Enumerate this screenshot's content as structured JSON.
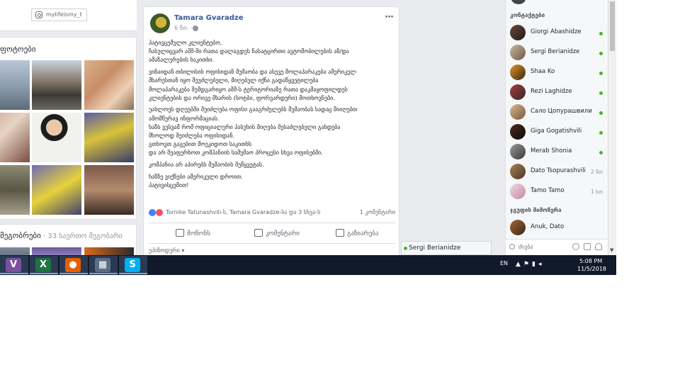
{
  "left_column": {
    "instagram_handle": "mylifeismy_t",
    "photos_title": "ფოტოები",
    "friends_title": "მეგობრები",
    "friends_count": " · 33 საერთო მეგობარი"
  },
  "post": {
    "author": "Tamara Gvaradze",
    "time": "6 წთ. ·",
    "menu_glyph": "···",
    "paragraphs": [
      "პატივცემულო კლიენტებო,\nჩასულიცვარ აშშ-ში რათა დალაგდეს ჩასატცირთი ავტომობილების აზ/და\nამაზალურების საკითხი.",
      "ვინაიდან თბილისის ოფისიდან მუშაობა და ასევე მოლაპარაკება ამერიკულ\nმხარესთან იყო შეუძლებელი, მიღებულ იქნა გადაწყვეტილება\nმოლაპარაკება შემდგარიყო აშშ-ს ტერიტორიაზე რათა დაკმაყოფილდეს\nკლიენტების და ორივე მხარის (სოტბი, ფორვარდერი) მოთხოვნები.",
      "უახლოეს დღეებში შეიძლება ოფისი გააგრძელებს მუშაობას სადაც მიიღებთ\nამომწურავ ინფორმაციას.\nხაზს ვუსვამ რომ ოფიციალური პასუხის მიღება შესაძლებელი გახდება\nმხოლოდ შეიძლება ოფისიდან.\nგთხოვთ გაგებით მოეკიდოთ საკითხს\nდა არ შეაფერხოთ კომპანიის სამუშაო პროცესი სხვა ოფისებში.",
      "კომპანია არ აპირებს მუშაობის შეწყვეტას.",
      "ხაზზე ვიქნები ამერიკული დროით.\nპატივისცემით!"
    ],
    "reactions_text": "Tornike Tatunashvili-ს, Tamara Gvaradze-სა და 3 სხვა-ს",
    "comment_count": "1 კომენტარი",
    "actions": {
      "like": "მოწონს",
      "comment": "კომენტარი",
      "share": "გაზიარება"
    },
    "more_comments": "ეპიზოდური ▾"
  },
  "chat_dock": {
    "name": "Sergi Berianidze"
  },
  "sidebar": {
    "contacts_heading": "კონტაქტები",
    "contacts": [
      {
        "name": "Giorgi Abashidze",
        "status": "online",
        "time": ""
      },
      {
        "name": "Sergi Berianidze",
        "status": "online",
        "time": ""
      },
      {
        "name": "Shaa Ko",
        "status": "online",
        "time": ""
      },
      {
        "name": "Rezi Laghidze",
        "status": "online",
        "time": ""
      },
      {
        "name": "Сало Цопурашвили",
        "status": "online",
        "time": ""
      },
      {
        "name": "Giga Gogatishvili",
        "status": "online",
        "time": ""
      },
      {
        "name": "Merab Shonia",
        "status": "online",
        "time": ""
      },
      {
        "name": "Dato Tsopurashvili",
        "status": "away",
        "time": "2 წთ"
      },
      {
        "name": "Tamo Tamo",
        "status": "away",
        "time": "1 სთ"
      }
    ],
    "group_heading": "ჯგუფის მიმოწერა",
    "group_contact": "Anuk, Dato",
    "search_placeholder": "ძიება"
  },
  "taskbar": {
    "apps": [
      {
        "name": "viber",
        "label": "V",
        "color": "#7b519d"
      },
      {
        "name": "excel",
        "label": "X",
        "color": "#1f7244"
      },
      {
        "name": "firefox",
        "label": "●",
        "color": "#e66000"
      },
      {
        "name": "calculator",
        "label": "▦",
        "color": "#5a6f87"
      },
      {
        "name": "skype",
        "label": "S",
        "color": "#00aff0"
      }
    ],
    "language": "EN",
    "time": "5:08 PM",
    "date": "11/5/2018"
  }
}
